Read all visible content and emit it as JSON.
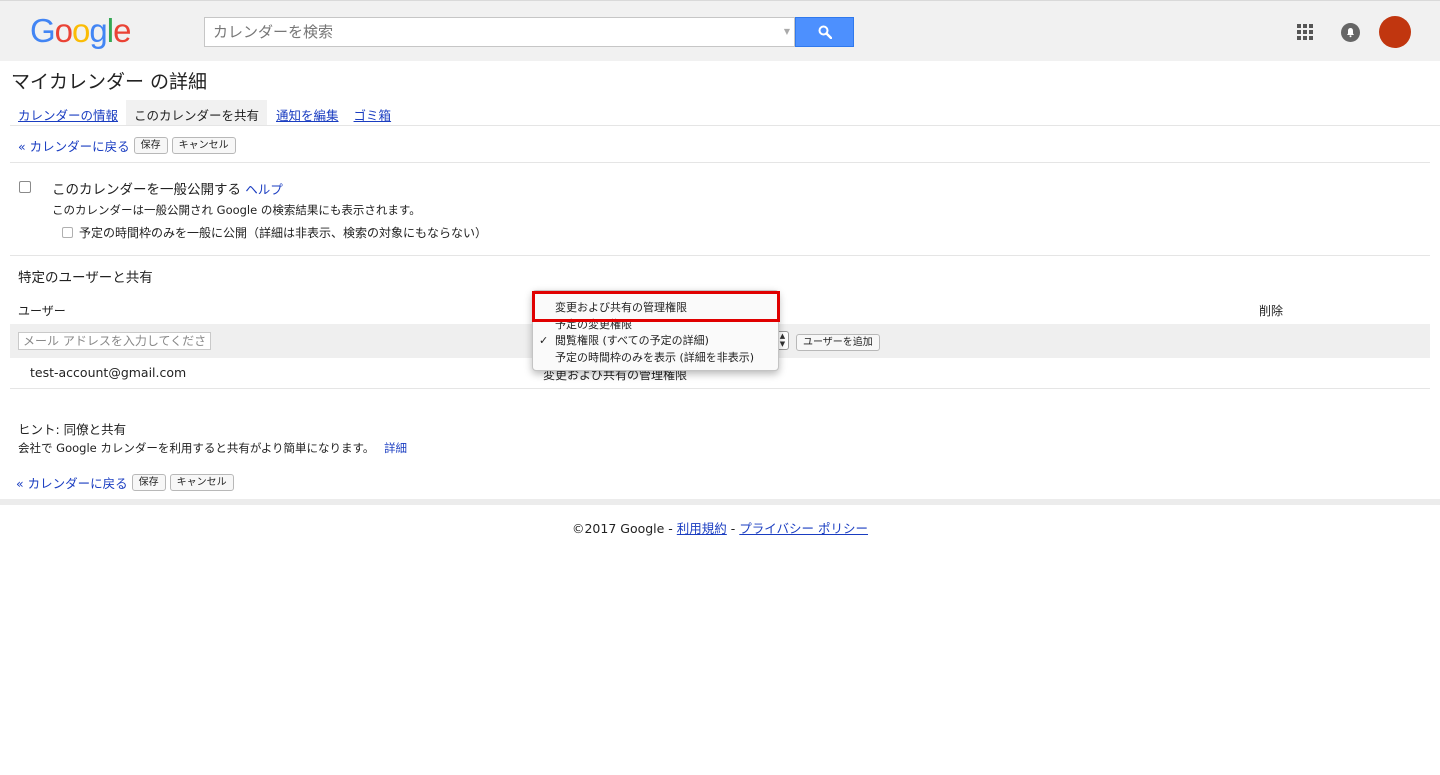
{
  "header": {
    "logo_letters": [
      "G",
      "o",
      "o",
      "g",
      "l",
      "e"
    ],
    "search": {
      "placeholder": "カレンダーを検索",
      "value": ""
    }
  },
  "page_title": "マイカレンダー の詳細",
  "tabs": [
    {
      "label": "カレンダーの情報",
      "active": false
    },
    {
      "label": "このカレンダーを共有",
      "active": true
    },
    {
      "label": "通知を編集",
      "active": false
    },
    {
      "label": "ゴミ箱",
      "active": false
    }
  ],
  "actions": {
    "back_label": "« カレンダーに戻る",
    "save_label": "保存",
    "cancel_label": "キャンセル"
  },
  "public_share": {
    "checkbox_label": "このカレンダーを一般公開する",
    "help_link": "ヘルプ",
    "description": "このカレンダーは一般公開され Google の検索結果にも表示されます。",
    "freebusy_label": "予定の時間枠のみを一般に公開（詳細は非表示、検索の対象にもならない）",
    "checked": false,
    "freebusy_checked": false
  },
  "specific_share": {
    "section_title": "特定のユーザーと共有",
    "col_user": "ユーザー",
    "col_delete": "削除",
    "email_placeholder": "メール アドレスを入力してくださ",
    "add_user_label": "ユーザーを追加",
    "permission_options": [
      "変更および共有の管理権限",
      "予定の変更権限",
      "閲覧権限 (すべての予定の詳細)",
      "予定の時間枠のみを表示 (詳細を非表示)"
    ],
    "selected_option_index": 2,
    "users": [
      {
        "email": "test-account@gmail.com",
        "permission": "変更および共有の管理権限"
      }
    ]
  },
  "hint": {
    "title": "ヒント: 同僚と共有",
    "text": "会社で Google カレンダーを利用すると共有がより簡単になります。",
    "link": "詳細"
  },
  "footer": {
    "copyright": "©2017 Google - ",
    "terms_link": "利用規約",
    "dash": " - ",
    "privacy_link": "プライバシー ポリシー"
  },
  "colors": {
    "link": "#1a3dc1",
    "search_button": "#4d90fe",
    "avatar": "#c1360f",
    "highlight_box": "#e00000"
  },
  "icons": {
    "search": "search-icon",
    "apps": "apps-grid-icon",
    "notifications": "bell-icon",
    "check": "checkmark-icon"
  }
}
